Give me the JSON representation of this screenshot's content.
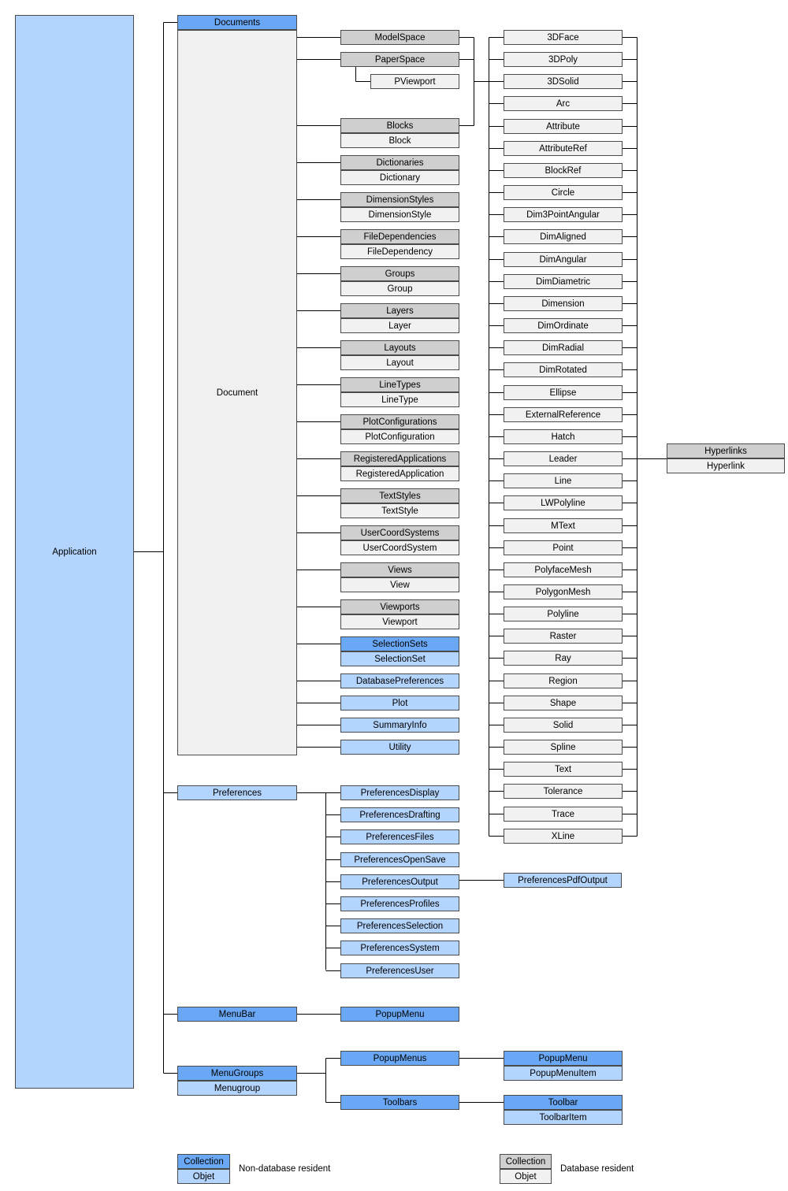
{
  "application": "Application",
  "documents": "Documents",
  "document": "Document",
  "model_space": "ModelSpace",
  "paper_space": "PaperSpace",
  "pviewport": "PViewport",
  "collections": [
    {
      "collection": "Blocks",
      "object": "Block"
    },
    {
      "collection": "Dictionaries",
      "object": "Dictionary"
    },
    {
      "collection": "DimensionStyles",
      "object": "DimensionStyle"
    },
    {
      "collection": "FileDependencies",
      "object": "FileDependency"
    },
    {
      "collection": "Groups",
      "object": "Group"
    },
    {
      "collection": "Layers",
      "object": "Layer"
    },
    {
      "collection": "Layouts",
      "object": "Layout"
    },
    {
      "collection": "LineTypes",
      "object": "LineType"
    },
    {
      "collection": "PlotConfigurations",
      "object": "PlotConfiguration"
    },
    {
      "collection": "RegisteredApplications",
      "object": "RegisteredApplication"
    },
    {
      "collection": "TextStyles",
      "object": "TextStyle"
    },
    {
      "collection": "UserCoordSystems",
      "object": "UserCoordSystem"
    },
    {
      "collection": "Views",
      "object": "View"
    },
    {
      "collection": "Viewports",
      "object": "Viewport"
    }
  ],
  "selection_sets": {
    "collection": "SelectionSets",
    "object": "SelectionSet"
  },
  "document_objects": [
    "DatabasePreferences",
    "Plot",
    "SummaryInfo",
    "Utility"
  ],
  "entities": [
    "3DFace",
    "3DPoly",
    "3DSolid",
    "Arc",
    "Attribute",
    "AttributeRef",
    "BlockRef",
    "Circle",
    "Dim3PointAngular",
    "DimAligned",
    "DimAngular",
    "DimDiametric",
    "Dimension",
    "DimOrdinate",
    "DimRadial",
    "DimRotated",
    "Ellipse",
    "ExternalReference",
    "Hatch",
    "Leader",
    "Line",
    "LWPolyline",
    "MText",
    "Point",
    "PolyfaceMesh",
    "PolygonMesh",
    "Polyline",
    "Raster",
    "Ray",
    "Region",
    "Shape",
    "Solid",
    "Spline",
    "Text",
    "Tolerance",
    "Trace",
    "XLine"
  ],
  "hyperlinks": {
    "collection": "Hyperlinks",
    "object": "Hyperlink"
  },
  "preferences": "Preferences",
  "preferences_children": [
    "PreferencesDisplay",
    "PreferencesDrafting",
    "PreferencesFiles",
    "PreferencesOpenSave",
    "PreferencesOutput",
    "PreferencesProfiles",
    "PreferencesSelection",
    "PreferencesSystem",
    "PreferencesUser"
  ],
  "preferences_pdf_output": "PreferencesPdfOutput",
  "menubar": "MenuBar",
  "menubar_popup_menu": "PopupMenu",
  "menugroups": {
    "collection": "MenuGroups",
    "object": "Menugroup"
  },
  "popup_menus": "PopupMenus",
  "popup_menu": {
    "collection": "PopupMenu",
    "object": "PopupMenuItem"
  },
  "toolbars": "Toolbars",
  "toolbar": {
    "collection": "Toolbar",
    "object": "ToolbarItem"
  },
  "legend": {
    "non_db": {
      "collection": "Collection",
      "object": "Objet",
      "label": "Non-database resident"
    },
    "db": {
      "collection": "Collection",
      "object": "Objet",
      "label": "Database resident"
    }
  },
  "colors": {
    "application": "#b3d4fc",
    "document": "#f0f0f0",
    "non_db_collection": "#6aa8f5",
    "non_db_object": "#b3d4fc",
    "db_collection": "#cfcfcf",
    "db_object": "#f1f1f1",
    "line": "#000000"
  }
}
